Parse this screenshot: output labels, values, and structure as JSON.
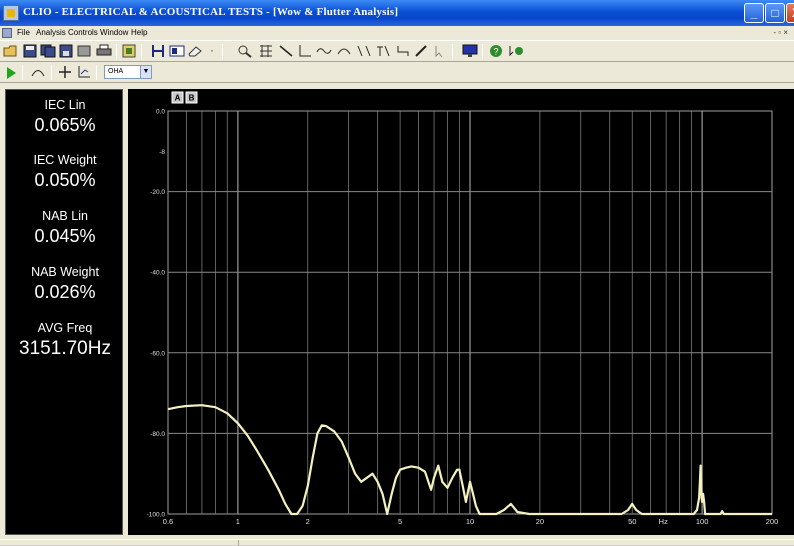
{
  "window": {
    "title": "CLIO - ELECTRICAL & ACOUSTICAL TESTS - [Wow & Flutter Analysis]",
    "controls": {
      "minimize": "_",
      "maximize": "□",
      "close": "X"
    }
  },
  "menu": {
    "items": [
      "File",
      "Analysis",
      "Controls",
      "Window",
      "Help"
    ],
    "mdi_controls": "- ▫ ×"
  },
  "toolbar2": {
    "scale_value": "OHA"
  },
  "results": [
    {
      "label": "IEC Lin",
      "value": "0.065%"
    },
    {
      "label": "IEC Weight",
      "value": "0.050%"
    },
    {
      "label": "NAB Lin",
      "value": "0.045%"
    },
    {
      "label": "NAB Weight",
      "value": "0.026%"
    },
    {
      "label": "AVG Freq",
      "value": "3151.70Hz"
    }
  ],
  "graph_buttons": [
    "A",
    "B"
  ],
  "chart_data": {
    "type": "line",
    "x_scale": "log",
    "xlim": [
      0.5,
      200
    ],
    "ylim": [
      -100,
      0
    ],
    "grid": true,
    "x_unit_label": "Hz",
    "x_ticks": [
      {
        "value": 0.5,
        "label": "0.6"
      },
      {
        "value": 1,
        "label": "1"
      },
      {
        "value": 2,
        "label": "2"
      },
      {
        "value": 5,
        "label": "5"
      },
      {
        "value": 10,
        "label": "10"
      },
      {
        "value": 20,
        "label": "20"
      },
      {
        "value": 50,
        "label": "50"
      },
      {
        "value": 100,
        "label": "100"
      },
      {
        "value": 200,
        "label": "200"
      }
    ],
    "y_ticks": [
      {
        "value": 0,
        "label": "0.0"
      },
      {
        "value": -10,
        "label": "-8"
      },
      {
        "value": -20,
        "label": "-20.0"
      },
      {
        "value": -40,
        "label": "-40.0"
      },
      {
        "value": -60,
        "label": "-60.0"
      },
      {
        "value": -80,
        "label": "-80.0"
      },
      {
        "value": -100,
        "label": "-100.0"
      }
    ],
    "series": [
      {
        "color": "#f5f0c0",
        "x": [
          0.5,
          0.55,
          0.6,
          0.7,
          0.8,
          0.9,
          1.0,
          1.1,
          1.2,
          1.35,
          1.5,
          1.6,
          1.7,
          1.8,
          1.9,
          2.0,
          2.1,
          2.2,
          2.3,
          2.4,
          2.6,
          2.8,
          3.0,
          3.2,
          3.4,
          3.6,
          3.8,
          4.0,
          4.2,
          4.4,
          4.6,
          4.8,
          5.0,
          5.3,
          5.6,
          6.0,
          6.4,
          6.8,
          7.0,
          7.3,
          7.6,
          8.0,
          8.4,
          8.8,
          9.0,
          9.3,
          9.6,
          10.0,
          10.3,
          10.6,
          11.0,
          11.5,
          12.0,
          13.0,
          14.0,
          15.0,
          16.0,
          18.0,
          20.0,
          25.0,
          30.0,
          40.0,
          45.0,
          48.0,
          50.0,
          52.0,
          55.0,
          70.0,
          85.0,
          92.0,
          95.0,
          97.0,
          98.0,
          98.5,
          99.0,
          99.5,
          100.0,
          101.0,
          102.0,
          103.0,
          105.0,
          110.0,
          120.0,
          122.0,
          124.0,
          130.0,
          160.0,
          200.0
        ],
        "y": [
          -74,
          -73.5,
          -73.2,
          -73,
          -73.5,
          -75,
          -77.5,
          -80.5,
          -84,
          -89,
          -94,
          -97.5,
          -100,
          -100,
          -98,
          -93,
          -86,
          -80,
          -78,
          -78.2,
          -79.5,
          -82,
          -86,
          -90,
          -92,
          -91,
          -90,
          -92,
          -95,
          -100,
          -95,
          -91,
          -89,
          -88.5,
          -88.2,
          -88.5,
          -89.5,
          -94,
          -91,
          -88,
          -92,
          -93.5,
          -91,
          -89,
          -89,
          -93,
          -97,
          -92,
          -95,
          -98,
          -100,
          -100,
          -100,
          -100,
          -99,
          -97.5,
          -99.5,
          -100,
          -100,
          -100,
          -100,
          -100,
          -100,
          -99,
          -97.5,
          -99,
          -100,
          -100,
          -100,
          -100,
          -99,
          -96,
          -91,
          -88,
          -93,
          -96,
          -97,
          -95,
          -97,
          -100,
          -100,
          -100,
          -100,
          -99.3,
          -100,
          -100,
          -100,
          -100
        ]
      }
    ]
  }
}
